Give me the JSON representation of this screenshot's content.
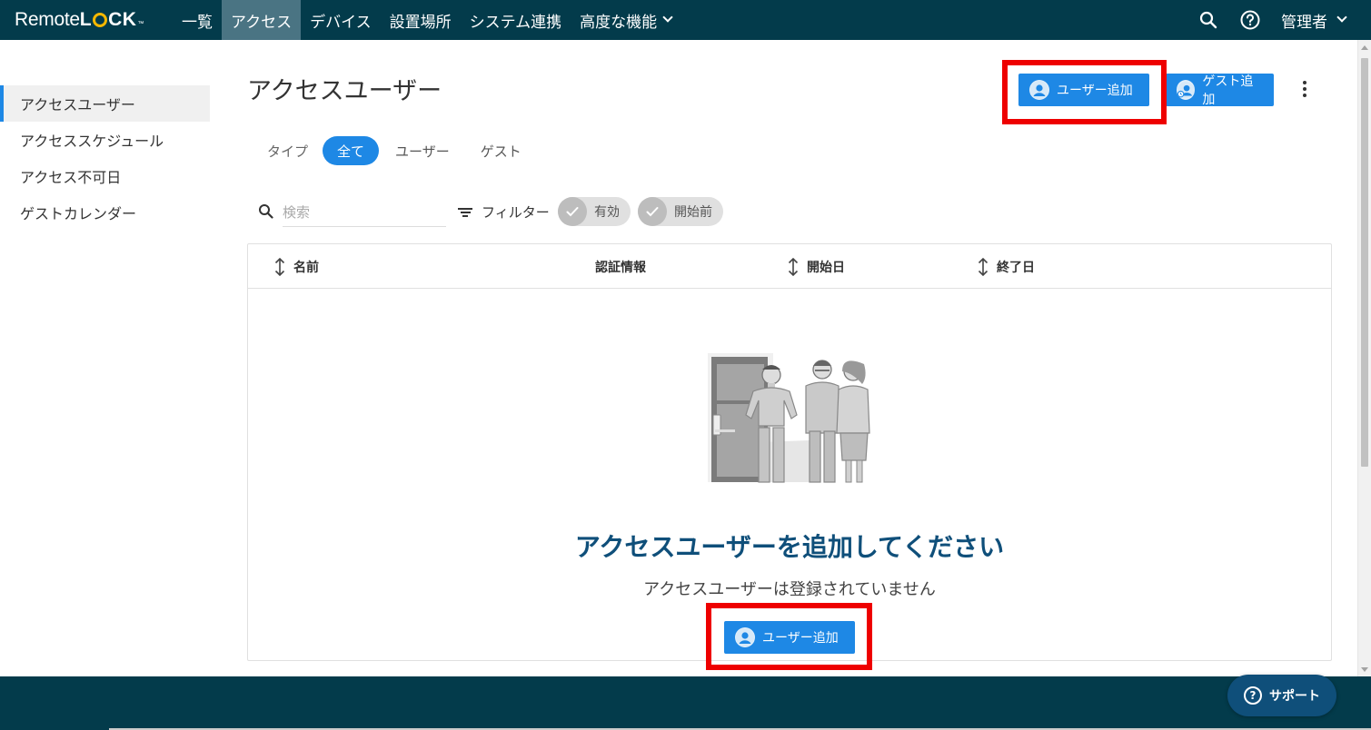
{
  "topbar": {
    "logo_text_a": "Remote",
    "logo_text_b_l": "L",
    "logo_text_b_ck": "CK",
    "logo_tm": "™",
    "nav": [
      {
        "label": "一覧"
      },
      {
        "label": "アクセス"
      },
      {
        "label": "デバイス"
      },
      {
        "label": "設置場所"
      },
      {
        "label": "システム連携"
      },
      {
        "label": "高度な機能"
      }
    ],
    "search_icon": "search-icon",
    "help_icon": "help-icon",
    "admin_label": "管理者"
  },
  "sidebar": {
    "items": [
      {
        "label": "アクセスユーザー"
      },
      {
        "label": "アクセススケジュール"
      },
      {
        "label": "アクセス不可日"
      },
      {
        "label": "ゲストカレンダー"
      }
    ]
  },
  "main": {
    "title": "アクセスユーザー",
    "add_user_label": "ユーザー追加",
    "add_guest_label": "ゲスト追加",
    "type_label": "タイプ",
    "type_tabs": [
      {
        "label": "全て"
      },
      {
        "label": "ユーザー"
      },
      {
        "label": "ゲスト"
      }
    ],
    "search_placeholder": "検索",
    "filter_label": "フィルター",
    "filter_chips": [
      {
        "label": "有効"
      },
      {
        "label": "開始前"
      }
    ],
    "columns": [
      {
        "label": "名前"
      },
      {
        "label": "認証情報"
      },
      {
        "label": "開始日"
      },
      {
        "label": "終了日"
      }
    ],
    "empty_title": "アクセスユーザーを追加してください",
    "empty_subtitle": "アクセスユーザーは登録されていません",
    "empty_add_user_label": "ユーザー追加"
  },
  "footer": {
    "support_label": "サポート"
  },
  "colors": {
    "navbar": "#033b4b",
    "primary": "#1e88e5",
    "highlight": "#ee0000",
    "empty_title": "#0f4f7a"
  }
}
